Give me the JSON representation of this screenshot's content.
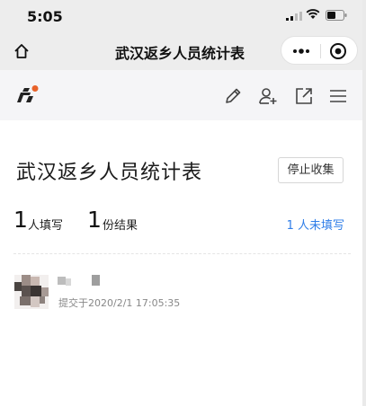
{
  "status_bar": {
    "time": "5:05"
  },
  "nav": {
    "title": "武汉返乡人员统计表"
  },
  "form": {
    "title": "武汉返乡人员统计表",
    "stop_label": "停止收集",
    "filled_count": "1",
    "filled_label": "人填写",
    "result_count": "1",
    "result_label": "份结果",
    "unfilled_link": "1 人未填写"
  },
  "responses": [
    {
      "submitted_text": "提交于2020/2/1 17:05:35"
    }
  ],
  "colors": {
    "accent": "#2f7ee8",
    "logo_dot": "#e8622a",
    "background": "#ffffff",
    "toolbar": "#f5f5f7"
  },
  "icons": [
    "signal-icon",
    "wifi-icon",
    "battery-icon",
    "home-icon",
    "more-dots-icon",
    "close-mini-icon",
    "logo-icon",
    "edit-icon",
    "add-user-icon",
    "share-icon",
    "menu-icon"
  ]
}
